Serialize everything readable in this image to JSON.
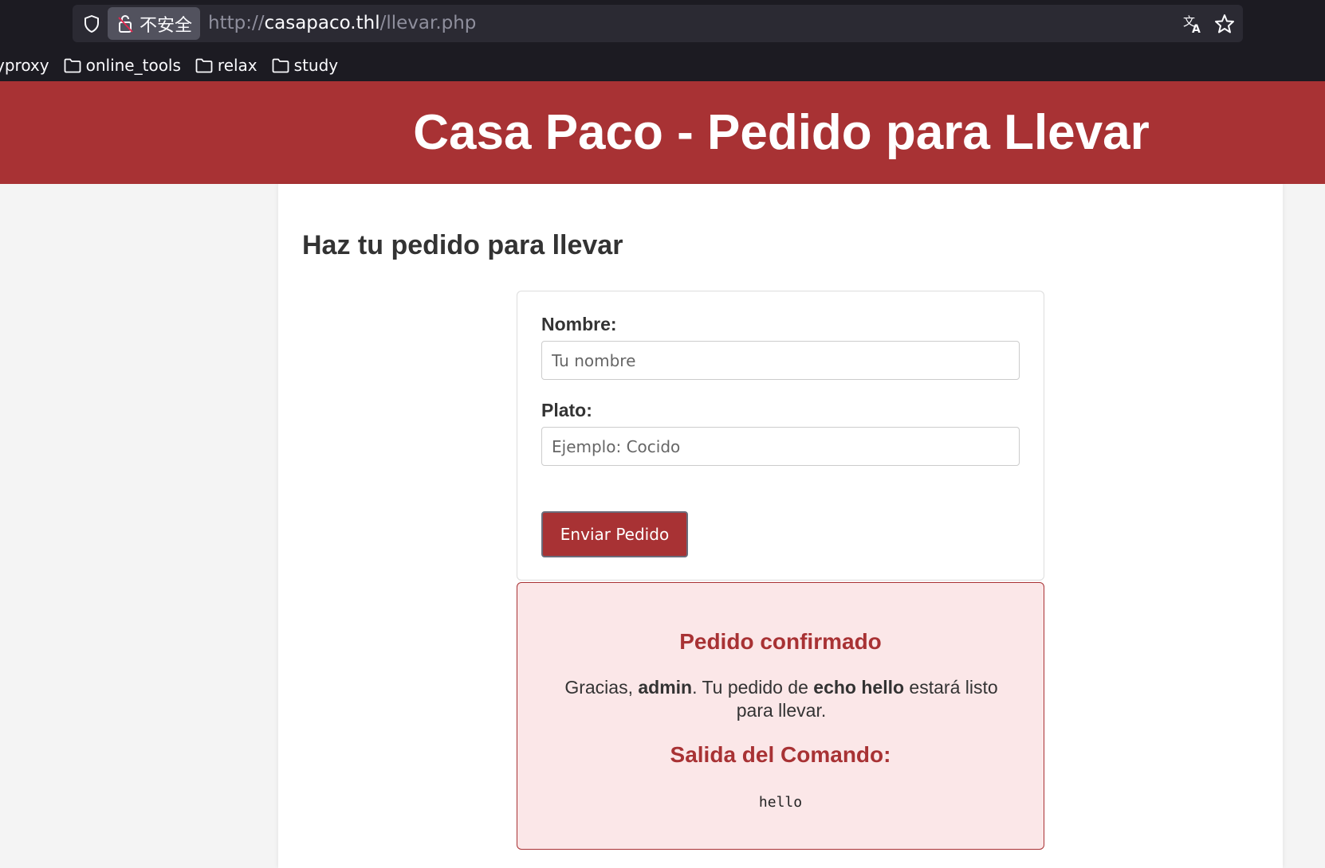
{
  "browser": {
    "insecure_label": "不安全",
    "url_scheme": "http://",
    "url_host": "casapaco.thl",
    "url_path": "/llevar.php",
    "bookmarks": [
      {
        "label": "yproxy"
      },
      {
        "label": "online_tools"
      },
      {
        "label": "relax"
      },
      {
        "label": "study"
      }
    ]
  },
  "header": {
    "title": "Casa Paco - Pedido para Llevar"
  },
  "main": {
    "section_title": "Haz tu pedido para llevar",
    "form": {
      "name_label": "Nombre:",
      "name_placeholder": "Tu nombre",
      "dish_label": "Plato:",
      "dish_placeholder": "Ejemplo: Cocido",
      "submit_label": "Enviar Pedido"
    },
    "result": {
      "title": "Pedido confirmado",
      "msg_prefix": "Gracias, ",
      "user": "admin",
      "msg_middle": ". Tu pedido de ",
      "dish": "echo hello",
      "msg_suffix": " estará listo para llevar.",
      "output_title": "Salida del Comando:",
      "output": "hello"
    }
  },
  "colors": {
    "brand": "#a83234",
    "result_bg": "#fbe7e8"
  }
}
